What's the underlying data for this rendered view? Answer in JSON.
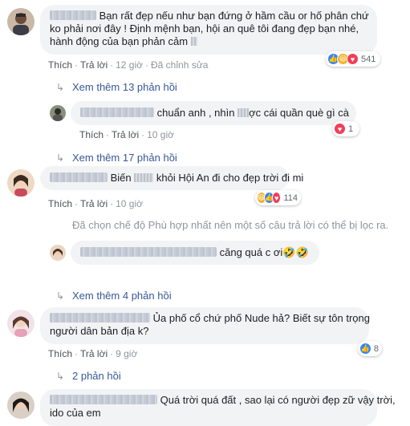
{
  "actions": {
    "like": "Thích",
    "reply": "Trả lời",
    "edited": "Đã chỉnh sửa"
  },
  "comments": [
    {
      "text_line1": "Bạn rất đẹp nếu như bạn đứng ở hầm cầu or hố phân chứ",
      "text_line2": "ko phải nơi đây ! Định mệnh bạn, hội an quê tôi đang đẹp bạn nhé,",
      "text_line3": "hành động của bạn phản cảm",
      "time": "12 giờ",
      "reaction_count": "541",
      "reactions": [
        "like-icon",
        "haha-icon",
        "love-icon"
      ],
      "replies_link": "Xem thêm 13 phản hồi"
    },
    {
      "text_a": "chuẩn anh , nhìn",
      "text_b": "ợc cái quần què gì cà",
      "time": "10 giờ",
      "reaction_count": "1",
      "reactions": [
        "love-icon"
      ],
      "replies_link": "Xem thêm 17 phản hồi"
    },
    {
      "text_a": "Biến",
      "text_b": "khỏi Hội An đi cho đẹp trời đi mi",
      "time": "10 giờ",
      "reaction_count": "114",
      "reactions": [
        "haha-icon",
        "like-icon",
        "love-icon"
      ]
    },
    {
      "text": "căng quá c ơi🤣🤣"
    },
    {
      "text_line1": "Ủa phố cổ chứ phố Nude hả? Biết sự tôn trọng",
      "text_line2": "người dân bản địa k?",
      "time": "9 giờ",
      "reaction_count": "8",
      "reactions": [
        "like-icon"
      ],
      "replies_link": "2 phản hồi"
    },
    {
      "text_line1": "Quá trời quá đất , sao lại có người đẹp zữ vậy trời,",
      "text_line2": "ido của em"
    }
  ],
  "filter_note": "Đã chọn chế độ Phù hợp nhất nên một số câu trả lời có thể bị lọc ra.",
  "replies_link_4": "Xem thêm 4 phản hồi",
  "colors": {
    "link": "#385898",
    "bubble": "#f2f3f5",
    "like": "#2d88ff",
    "haha": "#f7b125",
    "love": "#f33e58"
  }
}
